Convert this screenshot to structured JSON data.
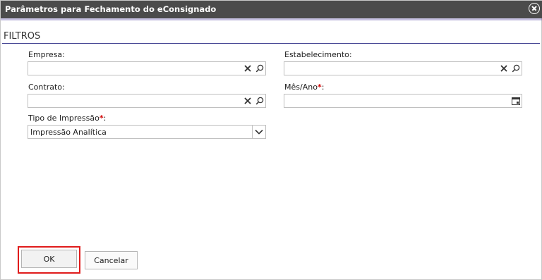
{
  "window": {
    "title": "Parâmetros para Fechamento do eConsignado",
    "close_icon": "close-circle-icon"
  },
  "section": {
    "title": "FILTROS"
  },
  "fields": {
    "empresa": {
      "label": "Empresa:",
      "value": ""
    },
    "estabelecimento": {
      "label": "Estabelecimento:",
      "value": ""
    },
    "contrato": {
      "label": "Contrato:",
      "value": ""
    },
    "mes_ano": {
      "label": "Mês/Ano",
      "required_mark": "*",
      "suffix": ":",
      "value": ""
    },
    "tipo_impressao": {
      "label": "Tipo de Impressão",
      "required_mark": "*",
      "suffix": ":",
      "selected": "Impressão Analítica"
    }
  },
  "buttons": {
    "ok": "OK",
    "cancel": "Cancelar"
  },
  "colors": {
    "titlebar": "#4b4b4b",
    "section_line": "#3d3e8f",
    "required": "#d00000",
    "highlight": "#e01b1b"
  }
}
